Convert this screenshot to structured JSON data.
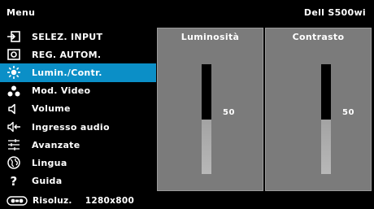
{
  "header": {
    "title": "Menu",
    "model": "Dell S500wi"
  },
  "menu": {
    "items": [
      {
        "icon": "input-source-icon",
        "label": "SELEZ. INPUT"
      },
      {
        "icon": "auto-adjust-icon",
        "label": "REG. AUTOM."
      },
      {
        "icon": "brightness-icon",
        "label": "Lumin./Contr.",
        "selected": true
      },
      {
        "icon": "video-mode-icon",
        "label": "Mod. Video"
      },
      {
        "icon": "volume-icon",
        "label": "Volume"
      },
      {
        "icon": "audio-input-icon",
        "label": "Ingresso audio"
      },
      {
        "icon": "advanced-settings-icon",
        "label": "Avanzate"
      },
      {
        "icon": "language-icon",
        "label": "Lingua"
      },
      {
        "icon": "help-icon",
        "label": "Guida"
      }
    ]
  },
  "panels": {
    "brightness": {
      "title": "Luminosità",
      "value": "50",
      "level": 0.5
    },
    "contrast": {
      "title": "Contrasto",
      "value": "50",
      "level": 0.5
    }
  },
  "footer": {
    "icon": "resolution-icon",
    "label": "Risoluz.",
    "value": "1280x800"
  },
  "colors": {
    "background": "#000000",
    "selected": "#0b8fc7",
    "panel": "#7b7b7b"
  }
}
